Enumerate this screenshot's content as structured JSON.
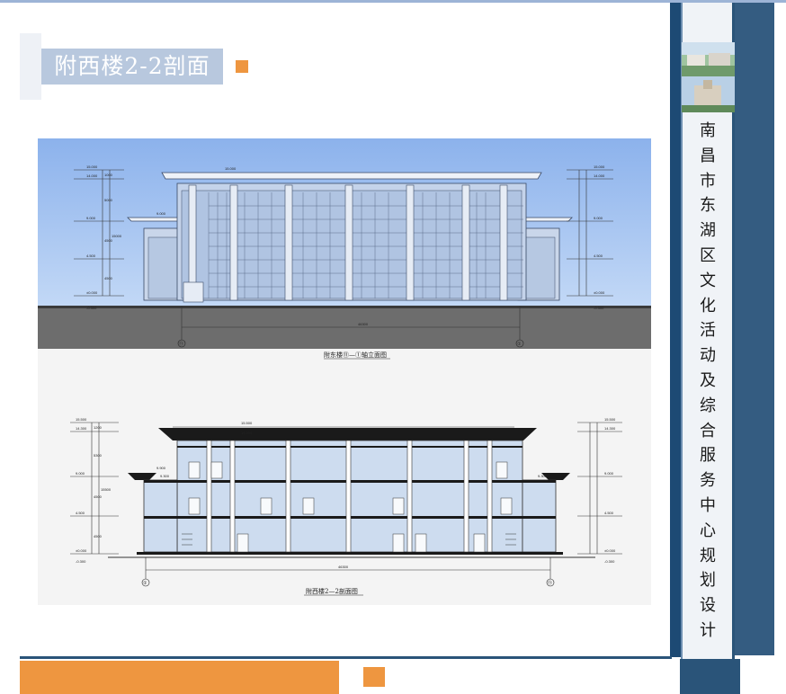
{
  "header": {
    "title": "附西楼2-2剖面"
  },
  "sidebar": {
    "vertical_title": [
      "南",
      "昌",
      "市",
      "东",
      "湖",
      "区",
      "文",
      "化",
      "活",
      "动",
      "及",
      "综",
      "合",
      "服",
      "务",
      "中",
      "心",
      "规",
      "划",
      "设",
      "计"
    ]
  },
  "drawing_top": {
    "caption": "附东楼⑪—①轴立面图",
    "left_levels": [
      "15.000",
      "14.000",
      "9.000",
      "4.500",
      "±0.000"
    ],
    "right_levels": [
      "15.000",
      "14.000",
      "9.000",
      "4.500",
      "±0.000"
    ],
    "top_level": "15.000",
    "side_level": "9.000",
    "dims_vertical": [
      "1000",
      "5000",
      "4500",
      "4500"
    ],
    "total_dim": "15000",
    "base_left": "-0.300",
    "base_right": "-0.300",
    "width_dim": "46300",
    "axis_left": "⑪",
    "axis_right": "①"
  },
  "drawing_bottom": {
    "caption": "附西楼2—2剖面图",
    "left_levels": [
      "15.500",
      "14.300",
      "9.000",
      "4.500",
      "±0.000"
    ],
    "right_levels": [
      "15.500",
      "14.300",
      "9.000",
      "4.500",
      "±0.000"
    ],
    "top_levels": [
      "15.500",
      "14.300"
    ],
    "side_levels": [
      "9.900",
      "9.300"
    ],
    "dims_vertical": [
      "1200",
      "5300",
      "4500",
      "4500"
    ],
    "total_dim": "15500",
    "base_left": "-0.300",
    "base_right": "-0.300",
    "width_dim": "46300",
    "axis_left": "①",
    "axis_right": "⑪"
  },
  "colors": {
    "accent_orange": "#ee9640",
    "title_blue": "#b8c8de",
    "navy": "#2a5479"
  }
}
